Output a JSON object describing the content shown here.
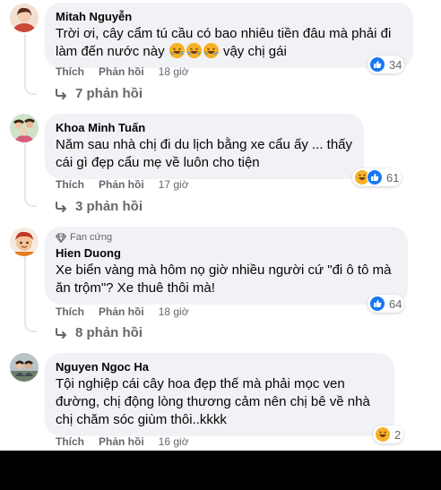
{
  "comments": [
    {
      "author": "Mitah Nguyễn",
      "text_before": "Trời ơi, cây cẩm tú cầu có bao nhiêu tiền đâu mà phải đi làm đến nước này",
      "text_after": "vậy chị gái",
      "like_label": "Thích",
      "reply_label": "Phản hồi",
      "time": "18 giờ",
      "reaction_count": "34",
      "reactions": [
        "like-icon"
      ],
      "replies": "7 phản hồi"
    },
    {
      "author": "Khoa Minh Tuấn",
      "text": "Năm sau nhà chị đi du lịch bằng xe cẩu ấy ... thấy cái gì đẹp cẩu mẹ về luôn cho tiện",
      "like_label": "Thích",
      "reply_label": "Phản hồi",
      "time": "17 giờ",
      "reaction_count": "61",
      "reactions": [
        "haha-icon",
        "like-icon"
      ],
      "replies": "3 phản hồi"
    },
    {
      "badge": "Fan cứng",
      "author": "Hien Duong",
      "text": "Xe biển vàng mà hôm nọ giờ nhiều người cứ \"đi ô tô mà ăn trộm\"? Xe thuê thôi mà!",
      "like_label": "Thích",
      "reply_label": "Phản hồi",
      "time": "18 giờ",
      "reaction_count": "64",
      "reactions": [
        "like-icon"
      ],
      "replies": "8 phản hồi"
    },
    {
      "author": "Nguyen Ngoc Ha",
      "text": "Tội nghiệp cái cây hoa đẹp thế mà phải mọc ven đường, chị động lòng thương cảm nên chị bê về nhà chị chăm sóc giùm thôi..kkkk",
      "like_label": "Thích",
      "reply_label": "Phản hồi",
      "time": "16 giờ",
      "reaction_count": "2",
      "reactions": [
        "haha-icon"
      ]
    }
  ],
  "colors": {
    "bubble": "#f0f2f5",
    "secondary_text": "#65676b",
    "like_blue": "#1877f2",
    "haha_yellow": "#f7b125"
  }
}
